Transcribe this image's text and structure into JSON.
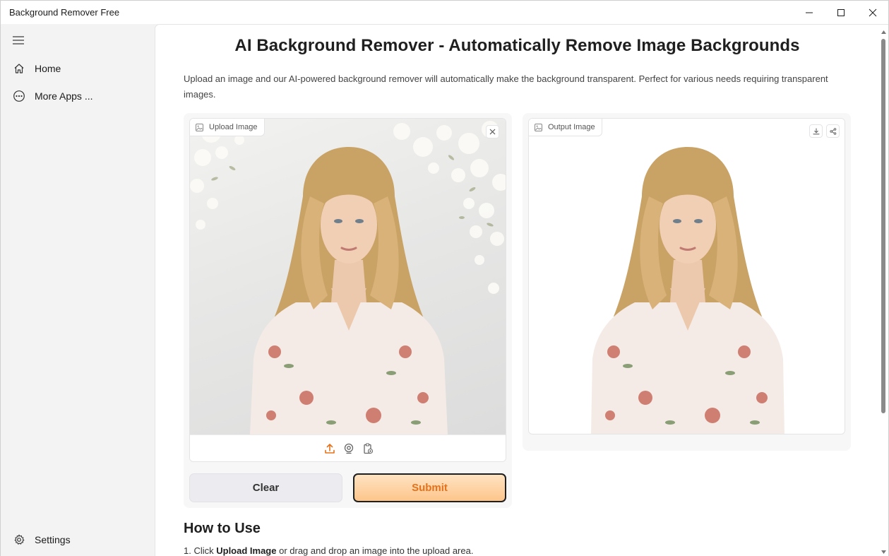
{
  "window": {
    "title": "Background Remover Free"
  },
  "sidebar": {
    "items": [
      {
        "label": "Home",
        "icon": "home-icon"
      },
      {
        "label": "More Apps ...",
        "icon": "more-apps-icon"
      }
    ],
    "settings_label": "Settings"
  },
  "main": {
    "title": "AI Background Remover - Automatically Remove Image Backgrounds",
    "description": "Upload an image and our AI-powered background remover will automatically make the background transparent. Perfect for various needs requiring transparent images.",
    "upload_panel": {
      "label": "Upload Image"
    },
    "output_panel": {
      "label": "Output Image"
    },
    "buttons": {
      "clear": "Clear",
      "submit": "Submit"
    },
    "how_to": {
      "title": "How to Use",
      "step1_prefix": "1. Click ",
      "step1_bold": "Upload Image",
      "step1_suffix": " or drag and drop an image into the upload area."
    }
  },
  "colors": {
    "accent": "#e5721b",
    "submit_bg_top": "#ffe3c2",
    "submit_bg_bottom": "#fdc58b"
  }
}
